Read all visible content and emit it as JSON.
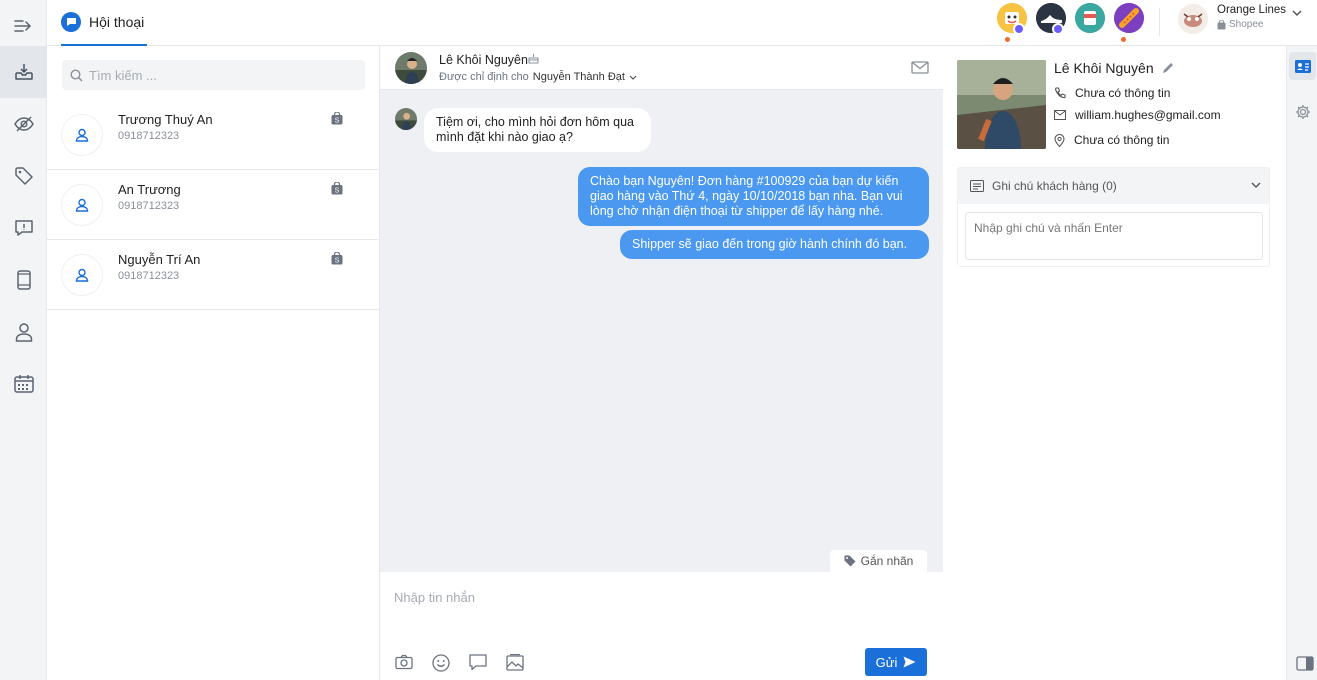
{
  "header": {
    "tab_label": "Hội thoại",
    "pages": [
      {
        "icon": "page-avatar-yellow-icon",
        "color": "#f6c343",
        "has_dot": true
      },
      {
        "icon": "page-avatar-shoe-icon",
        "color": "#2b3442",
        "has_dot": false
      },
      {
        "icon": "page-avatar-cup-icon",
        "color": "#3aa7a0",
        "has_dot": false
      },
      {
        "icon": "page-avatar-purple-icon",
        "color": "#7b3fbf",
        "has_dot": true
      }
    ],
    "account": {
      "name": "Orange Lines",
      "channel": "Shopee"
    }
  },
  "rail": {
    "items": [
      "collapse-arrow-icon",
      "inbox-icon",
      "hidden-eye-icon",
      "tag-icon",
      "feedback-icon",
      "mobile-icon",
      "customer-icon",
      "calendar-icon"
    ]
  },
  "list": {
    "search_placeholder": "Tìm kiếm ...",
    "conversations": [
      {
        "name": "Trương Thuý An",
        "phone": "0918712323"
      },
      {
        "name": "An Trương",
        "phone": "0918712323"
      },
      {
        "name": "Nguyễn Trí An",
        "phone": "0918712323"
      }
    ]
  },
  "chat": {
    "contact_name": "Lê Khôi Nguyên",
    "assigned_prefix": "Được chỉ định cho",
    "assigned_to": "Nguyễn Thành Đạt",
    "messages": {
      "incoming_1": "Tiệm ơi, cho mình hỏi đơn hôm qua mình đặt khi nào giao ạ?",
      "outgoing_1": "Chào bạn Nguyên! Đơn hàng #100929 của bạn dự kiến giao hàng vào Thứ 4, ngày 10/10/2018 bạn nha. Bạn vui lòng chờ nhận điện thoại từ shipper để lấy hàng nhé.",
      "outgoing_2": "Shipper sẽ giao đến trong giờ hành chính đó bạn."
    },
    "label_button": "Gắn nhãn",
    "composer_placeholder": "Nhập tin nhắn",
    "send_label": "Gửi"
  },
  "profile": {
    "name": "Lê Khôi Nguyên",
    "phone": "Chưa có thông tin",
    "email": "william.hughes@gmail.com",
    "address": "Chưa có thông tin",
    "notes_title": "Ghi chú khách hàng (0)",
    "notes_placeholder": "Nhập ghi chú và nhấn Enter"
  },
  "colors": {
    "accent": "#1a6fd8",
    "bubble_out": "#4a98f0",
    "chat_bg": "#eef0f3",
    "notify_dot": "#f26a2e"
  }
}
